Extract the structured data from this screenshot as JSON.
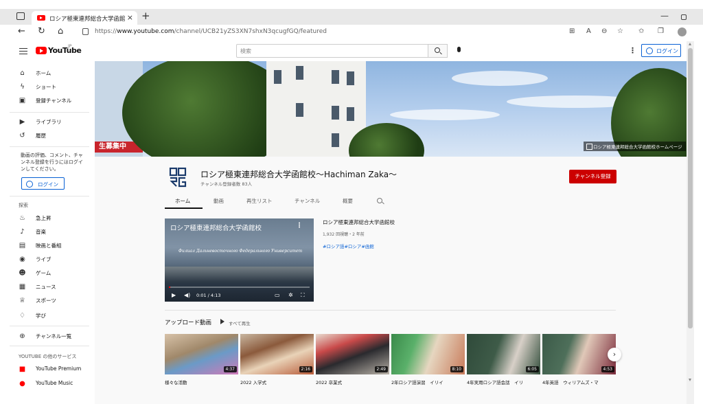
{
  "browser": {
    "tab_title": "ロシア極東連邦総合大学函館校～",
    "new_tab": "+",
    "tab_close": "×",
    "url_prefix": "https://",
    "url_host": "www.youtube.com",
    "url_path": "/channel/UCB21yZS3XN7shxN3qcugfGQ/featured"
  },
  "masthead": {
    "logo_text": "YouTube",
    "logo_region": "JP",
    "search_placeholder": "検索",
    "login_label": "ログイン"
  },
  "sidebar": {
    "main": [
      {
        "label": "ホーム",
        "icon": "home-icon"
      },
      {
        "label": "ショート",
        "icon": "shorts-icon"
      },
      {
        "label": "登録チャンネル",
        "icon": "subscriptions-icon"
      }
    ],
    "library": [
      {
        "label": "ライブラリ",
        "icon": "library-icon"
      },
      {
        "label": "履歴",
        "icon": "history-icon"
      }
    ],
    "note": "動画の評価、コメント、チャンネル登録を行うにはログインしてください。",
    "login_label": "ログイン",
    "explore_heading": "探索",
    "explore": [
      {
        "label": "急上昇",
        "icon": "trending-icon"
      },
      {
        "label": "音楽",
        "icon": "music-icon"
      },
      {
        "label": "映画と番組",
        "icon": "movies-icon"
      },
      {
        "label": "ライブ",
        "icon": "live-icon"
      },
      {
        "label": "ゲーム",
        "icon": "gaming-icon"
      },
      {
        "label": "ニュース",
        "icon": "news-icon"
      },
      {
        "label": "スポーツ",
        "icon": "sports-icon"
      },
      {
        "label": "学び",
        "icon": "learning-icon"
      }
    ],
    "browse_channels": "チャンネル一覧",
    "services_heading": "YOUTUBE の他のサービス",
    "services": [
      {
        "label": "YouTube Premium"
      },
      {
        "label": "YouTube Music"
      }
    ]
  },
  "banner": {
    "sign_text": "生募集中",
    "link_label": "ロシア極東連邦総合大学函館校ホームページ"
  },
  "channel": {
    "name": "ロシア極東連邦総合大学函館校～Hachiman Zaka～",
    "subscribers": "チャンネル登録者数 83人",
    "subscribe_label": "チャンネル登録",
    "tabs": [
      {
        "label": "ホーム"
      },
      {
        "label": "動画"
      },
      {
        "label": "再生リスト"
      },
      {
        "label": "チャンネル"
      },
      {
        "label": "概要"
      }
    ]
  },
  "featured": {
    "player_title": "ロシア極東連邦総合大学函館校",
    "overlay_text": "Филиал Дальневосточного Федерального Университета в г. Хакодате",
    "time": "0:01 / 4:13",
    "progress": 0.004,
    "title": "ロシア極東連邦総合大学函館校",
    "meta": "1,932 回視聴・2 年前",
    "tags": "#ロシア語#ロシア#函館"
  },
  "uploads": {
    "heading": "アップロード動画",
    "play_all": "すべて再生",
    "videos": [
      {
        "title": "様々な活動",
        "duration": "4:37"
      },
      {
        "title": "2022 入学式",
        "duration": "2:16"
      },
      {
        "title": "2022 卒業式",
        "duration": "2:49"
      },
      {
        "title": "2年ロシア語演習　イリイ",
        "duration": "8:10"
      },
      {
        "title": "4年実用ロシア語会話　イリ",
        "duration": "6:05"
      },
      {
        "title": "4年英語　ウィリアムズ・マ",
        "duration": "4:53"
      }
    ]
  },
  "colors": {
    "yt_red": "#ff0000",
    "subscribe_red": "#cc0000",
    "link_blue": "#065fd4"
  }
}
